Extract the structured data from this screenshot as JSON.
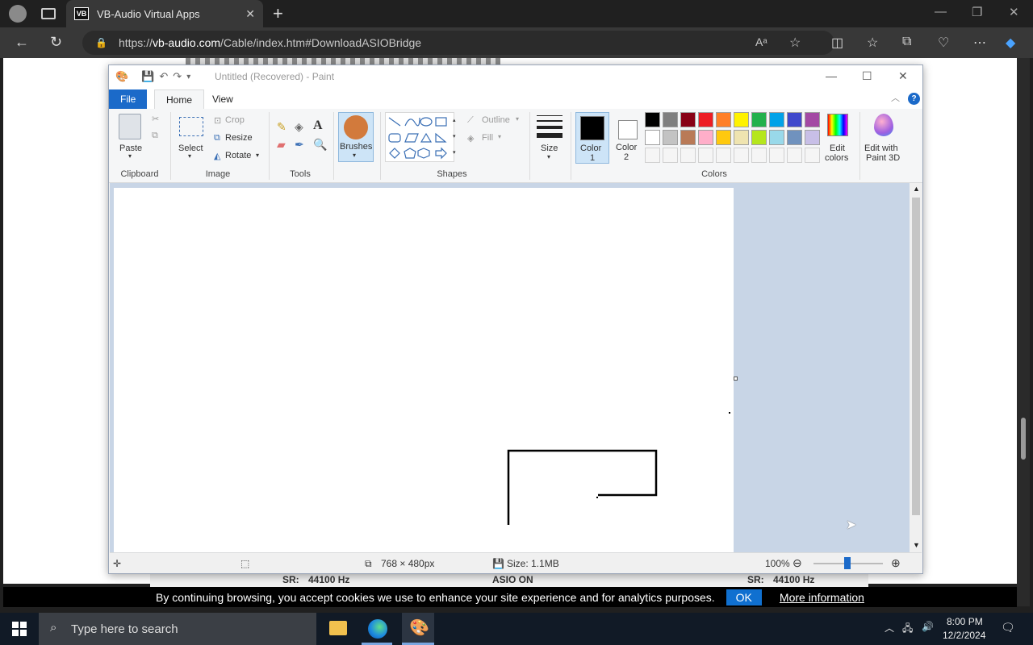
{
  "browser": {
    "tab_title": "VB-Audio Virtual Apps",
    "tab_favicon": "VB",
    "url_prefix": "https://",
    "url_host": "vb-audio.com",
    "url_path": "/Cable/index.htm#DownloadASIOBridge"
  },
  "paint": {
    "title": "Untitled (Recovered) - Paint",
    "tabs": {
      "file": "File",
      "home": "Home",
      "view": "View"
    },
    "clipboard": {
      "paste": "Paste",
      "group": "Clipboard"
    },
    "image": {
      "select": "Select",
      "crop": "Crop",
      "resize": "Resize",
      "rotate": "Rotate",
      "group": "Image"
    },
    "tools": {
      "group": "Tools"
    },
    "brushes": {
      "label": "Brushes"
    },
    "shapes": {
      "outline": "Outline",
      "fill": "Fill",
      "group": "Shapes"
    },
    "size": {
      "label": "Size"
    },
    "color1": {
      "label": "Color",
      "num": "1"
    },
    "color2": {
      "label": "Color",
      "num": "2"
    },
    "colors": {
      "group": "Colors",
      "row1": [
        "#000000",
        "#7f7f7f",
        "#880015",
        "#ed1c24",
        "#ff7f27",
        "#fff200",
        "#22b14c",
        "#00a2e8",
        "#3f48cc",
        "#a349a4"
      ],
      "row2": [
        "#ffffff",
        "#c3c3c3",
        "#b97a57",
        "#ffaec9",
        "#ffc90e",
        "#efe4b0",
        "#b5e61d",
        "#99d9ea",
        "#7092be",
        "#c8bfe7"
      ]
    },
    "edit_colors": {
      "line1": "Edit",
      "line2": "colors"
    },
    "paint3d": {
      "line1": "Edit with",
      "line2": "Paint 3D"
    },
    "status": {
      "dimensions": "768 × 480px",
      "size": "Size: 1.1MB",
      "zoom": "100%"
    }
  },
  "page_behind": {
    "sr_left": "SR:",
    "hz_left": "44100 Hz",
    "asio": "ASIO ON",
    "sr_right": "SR:",
    "hz_right": "44100 Hz"
  },
  "cookie": {
    "text": "By continuing browsing, you accept cookies we use to enhance your site experience and for analytics purposes.",
    "ok": "OK",
    "more": "More information"
  },
  "taskbar": {
    "search_placeholder": "Type here to search",
    "time": "8:00 PM",
    "date": "12/2/2024"
  }
}
